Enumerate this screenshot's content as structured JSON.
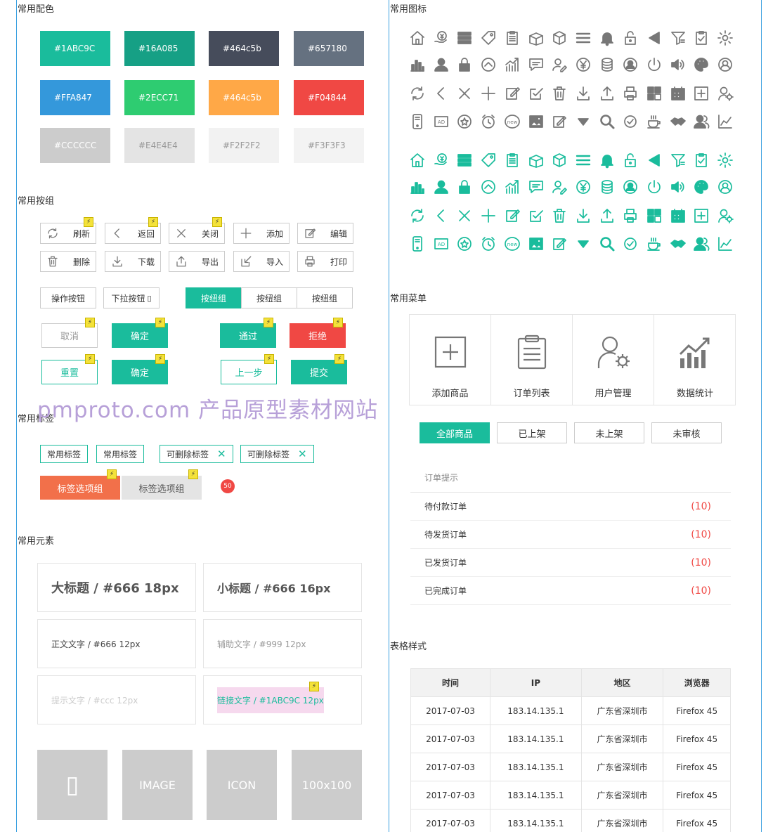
{
  "sections": {
    "colors": "常用配色",
    "buttons": "常用按组",
    "tags": "常用标签",
    "elements": "常用元素",
    "icons": "常用图标",
    "menu": "常用菜单",
    "table": "表格样式"
  },
  "swatches": [
    {
      "label": "#1ABC9C",
      "bg": "#1ABC9C",
      "fg": "#ffffff"
    },
    {
      "label": "#16A085",
      "bg": "#16A085",
      "fg": "#ffffff"
    },
    {
      "label": "#464c5b",
      "bg": "#464c5b",
      "fg": "#ffffff"
    },
    {
      "label": "#657180",
      "bg": "#657180",
      "fg": "#ffffff"
    },
    {
      "label": "#FFA847",
      "bg": "#3498DB",
      "fg": "#ffffff"
    },
    {
      "label": "#2ECC71",
      "bg": "#2ECC71",
      "fg": "#ffffff"
    },
    {
      "label": "#464c5b",
      "bg": "#FFA847",
      "fg": "#ffffff"
    },
    {
      "label": "#F04844",
      "bg": "#F04844",
      "fg": "#ffffff"
    },
    {
      "label": "#CCCCCC",
      "bg": "#CCCCCC",
      "fg": "#ffffff"
    },
    {
      "label": "#E4E4E4",
      "bg": "#E4E4E4",
      "fg": "#999999"
    },
    {
      "label": "#F2F2F2",
      "bg": "#F2F2F2",
      "fg": "#999999"
    },
    {
      "label": "#F3F3F3",
      "bg": "#F3F3F3",
      "fg": "#999999"
    }
  ],
  "icon_buttons": [
    {
      "label": "刷新",
      "icon": "refresh-icon"
    },
    {
      "label": "返回",
      "icon": "chevron-left-icon"
    },
    {
      "label": "关闭",
      "icon": "close-icon"
    },
    {
      "label": "添加",
      "icon": "plus-icon"
    },
    {
      "label": "编辑",
      "icon": "edit-icon"
    },
    {
      "label": "删除",
      "icon": "trash-icon"
    },
    {
      "label": "下载",
      "icon": "download-icon"
    },
    {
      "label": "导出",
      "icon": "export-icon"
    },
    {
      "label": "导入",
      "icon": "import-icon"
    },
    {
      "label": "打印",
      "icon": "print-icon"
    }
  ],
  "misc_buttons": {
    "op": "操作按钮",
    "dropdown": "下拉按钮",
    "dropdown_glyph": "▯",
    "group": [
      "按纽组",
      "按纽组",
      "按纽组"
    ],
    "cancel": "取消",
    "ok": "确定",
    "pass": "通过",
    "reject": "拒绝",
    "reset": "重置",
    "confirm": "确定",
    "prev": "上一步",
    "submit": "提交"
  },
  "watermark": "pmproto.com 产品原型素材网站",
  "tags": {
    "plain": [
      "常用标签",
      "常用标签"
    ],
    "removable": [
      "可删除标签",
      "可删除标签"
    ],
    "remove_glyph": "✕",
    "options": [
      "标签选项组",
      "标签选项组"
    ],
    "badge": "50"
  },
  "elements": {
    "h1": "大标题 / #666  18px",
    "h2": "小标题 / #666  16px",
    "body": "正文文字 / #666  12px",
    "aux": "辅助文字 / #999  12px",
    "hint": "提示文字 / #ccc  12px",
    "link": "链接文字 / #1ABC9C  12px",
    "images": [
      "▯",
      "IMAGE",
      "ICON",
      "100x100"
    ]
  },
  "icon_grid": [
    [
      "home",
      "money-hand",
      "list-bars",
      "tag",
      "clipboard",
      "box-open",
      "cube",
      "menu",
      "bell",
      "unlock",
      "triangle-left",
      "filter",
      "check-clipboard",
      "gear"
    ],
    [
      "bar-chart",
      "user",
      "lock",
      "chevron-up-circle",
      "trend-chart",
      "message",
      "user-edit",
      "yen-circle",
      "coins",
      "user-circle",
      "power",
      "volume",
      "palette",
      "account-circle"
    ],
    [
      "refresh",
      "chevron-left",
      "close",
      "plus",
      "edit",
      "check-edit",
      "trash",
      "download",
      "upload",
      "printer",
      "grid",
      "calendar",
      "add-box",
      "user-settings"
    ],
    [
      "device",
      "ad",
      "star-circle",
      "alarm",
      "new-badge",
      "image",
      "pencil-square",
      "caret-down",
      "search",
      "check-circle",
      "coffee",
      "handshake",
      "users",
      "line-chart"
    ]
  ],
  "menu": [
    {
      "label": "添加商品",
      "icon": "add-box-icon"
    },
    {
      "label": "订单列表",
      "icon": "clipboard-list-icon"
    },
    {
      "label": "用户管理",
      "icon": "user-settings-icon"
    },
    {
      "label": "数据统计",
      "icon": "stats-chart-icon"
    }
  ],
  "filter_tabs": [
    "全部商品",
    "已上架",
    "未上架",
    "未审核"
  ],
  "orders": {
    "title": "订单提示",
    "rows": [
      {
        "label": "待付款订单",
        "count": "(10)"
      },
      {
        "label": "待发货订单",
        "count": "(10)"
      },
      {
        "label": "已发货订单",
        "count": "(10)"
      },
      {
        "label": "已完成订单",
        "count": "(10)"
      }
    ]
  },
  "table": {
    "headers": [
      "时间",
      "IP",
      "地区",
      "浏览器"
    ],
    "rows": [
      [
        "2017-07-03",
        "183.14.135.1",
        "广东省深圳市",
        "Firefox 45"
      ],
      [
        "2017-07-03",
        "183.14.135.1",
        "广东省深圳市",
        "Firefox 45"
      ],
      [
        "2017-07-03",
        "183.14.135.1",
        "广东省深圳市",
        "Firefox 45"
      ],
      [
        "2017-07-03",
        "183.14.135.1",
        "广东省深圳市",
        "Firefox 45"
      ],
      [
        "2017-07-03",
        "183.14.135.1",
        "广东省深圳市",
        "Firefox 45"
      ]
    ]
  },
  "colors": {
    "accent": "#1ABC9C",
    "danger": "#F04844",
    "orange": "#F2704A",
    "icon_gray": "#777777"
  }
}
